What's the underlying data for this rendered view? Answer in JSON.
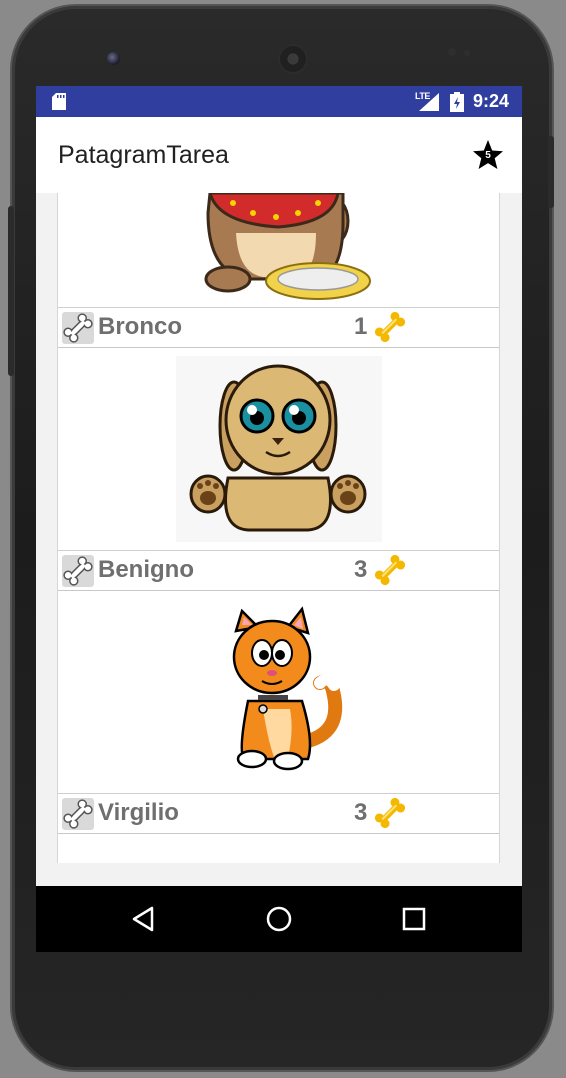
{
  "status_bar": {
    "time": "9:24",
    "network": "LTE",
    "icons": [
      "sd-card-icon",
      "signal-icon",
      "battery-icon"
    ]
  },
  "app_bar": {
    "title": "PatagramTarea",
    "favorites_count": "5",
    "icon": "star-icon"
  },
  "pets": [
    {
      "name": "Bronco",
      "rating": "1",
      "image": "dog-with-bowl"
    },
    {
      "name": "Benigno",
      "rating": "3",
      "image": "puppy"
    },
    {
      "name": "Virgilio",
      "rating": "3",
      "image": "orange-cat"
    }
  ],
  "nav_bar": {
    "buttons": [
      "back-icon",
      "home-icon",
      "recents-icon"
    ]
  },
  "colors": {
    "status_bar": "#303f9f",
    "app_bar": "#ffffff",
    "text_primary": "#212121",
    "card_text": "#6f6f6f",
    "bone_gold": "#f5b800"
  }
}
